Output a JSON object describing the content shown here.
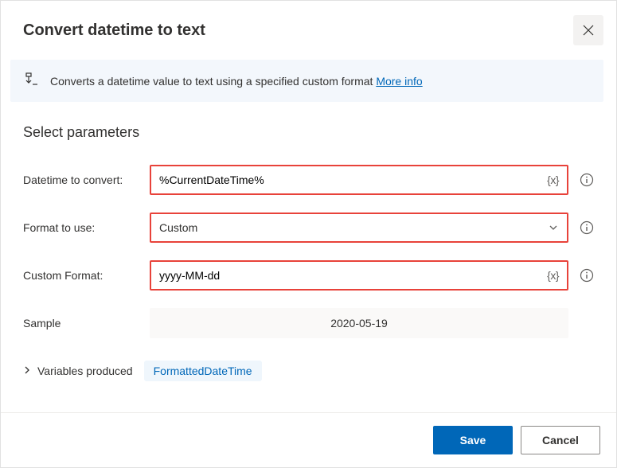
{
  "header": {
    "title": "Convert datetime to text"
  },
  "description": {
    "text": "Converts a datetime value to text using a specified custom format ",
    "moreInfo": "More info"
  },
  "section": {
    "title": "Select parameters"
  },
  "fields": {
    "datetime": {
      "label": "Datetime to convert:",
      "value": "%CurrentDateTime%",
      "vartoken": "{x}"
    },
    "format": {
      "label": "Format to use:",
      "value": "Custom"
    },
    "custom": {
      "label": "Custom Format:",
      "value": "yyyy-MM-dd",
      "vartoken": "{x}"
    },
    "sample": {
      "label": "Sample",
      "value": "2020-05-19"
    }
  },
  "variablesProduced": {
    "label": "Variables produced",
    "variable": "FormattedDateTime"
  },
  "footer": {
    "save": "Save",
    "cancel": "Cancel"
  }
}
